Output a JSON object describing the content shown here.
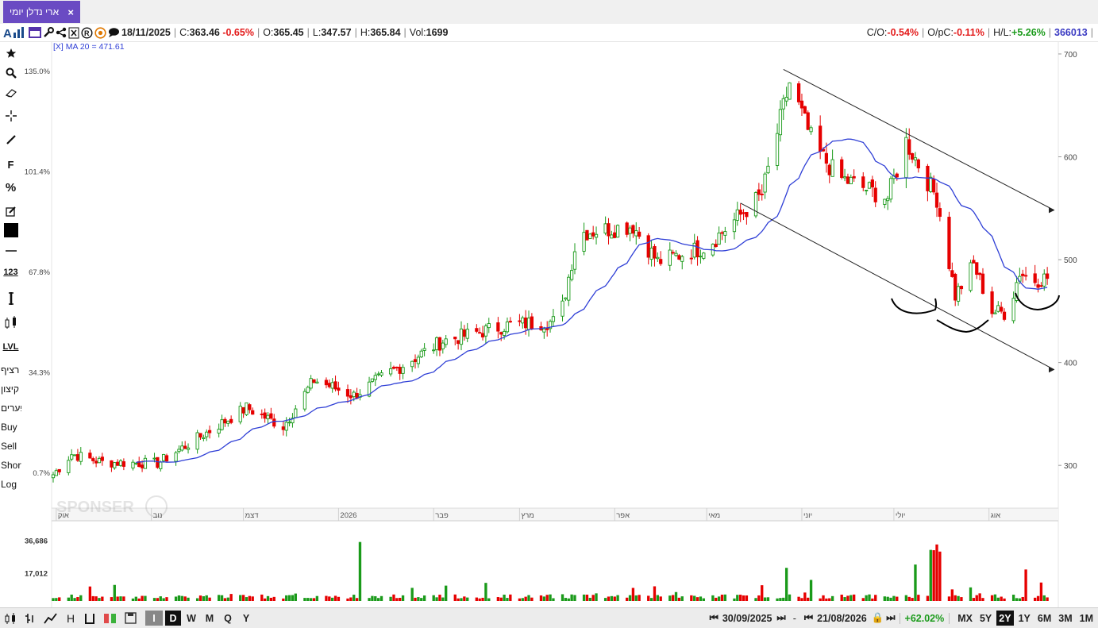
{
  "tab": {
    "label": "ארי נדלן יומי",
    "close": "×"
  },
  "infobar": {
    "date": "18/11/2025",
    "close_label": "C:",
    "close_value": "363.46",
    "close_change": "-0.65%",
    "open_label": "O:",
    "open_value": "365.45",
    "low_label": "L:",
    "low_value": "347.57",
    "high_label": "H:",
    "high_value": "365.84",
    "vol_label": "Vol:",
    "vol_value": "1699",
    "co_label": "C/O:",
    "co_value": "-0.54%",
    "opc_label": "O/pC:",
    "opc_value": "-0.11%",
    "hl_label": "H/L:",
    "hl_value": "+5.26%",
    "security_id": "366013"
  },
  "toolbar_left": {
    "font_label": "F",
    "percent_label": "%",
    "number_label": "123",
    "level_label": "LVL",
    "continuous": "רציף",
    "extreme": "קיצון",
    "gaps": "פערים",
    "buy": "Buy",
    "sell": "Sell",
    "short": "Short",
    "log": "Log"
  },
  "chart": {
    "indicator_label": "[X] MA 20 = 471.61",
    "watermark": "SPONSER",
    "pct_ticks": [
      "135.0%",
      "101.4%",
      "67.8%",
      "34.3%",
      "0.7%"
    ],
    "price_ticks": [
      "700",
      "600",
      "500",
      "400",
      "300"
    ],
    "month_labels": [
      "אוק",
      "נוב",
      "דצמ",
      "2026",
      "פבר",
      "מרץ",
      "אפר",
      "מאי",
      "יוני",
      "יולי",
      "אוג"
    ],
    "volume_ticks": [
      "36,686",
      "17,012"
    ],
    "colors": {
      "up": "#1a9a1a",
      "down": "#e60000",
      "ma": "#2f3fd6",
      "grid": "#dcdcdc"
    }
  },
  "chart_data": {
    "type": "candlestick",
    "x_range": [
      "2025-09-30",
      "2026-08-21"
    ],
    "ylim": [
      260,
      710
    ],
    "moving_average": {
      "name": "MA 20",
      "last_value": 471.61
    },
    "close_anchors": [
      {
        "date": "2025-09-30",
        "close": 291
      },
      {
        "date": "2025-10-06",
        "close": 311
      },
      {
        "date": "2025-10-16",
        "close": 303
      },
      {
        "date": "2025-11-03",
        "close": 302
      },
      {
        "date": "2025-11-18",
        "close": 330
      },
      {
        "date": "2025-12-02",
        "close": 356
      },
      {
        "date": "2025-12-14",
        "close": 338
      },
      {
        "date": "2025-12-24",
        "close": 383
      },
      {
        "date": "2026-01-06",
        "close": 368
      },
      {
        "date": "2026-01-16",
        "close": 387
      },
      {
        "date": "2026-02-04",
        "close": 421
      },
      {
        "date": "2026-02-26",
        "close": 437
      },
      {
        "date": "2026-03-14",
        "close": 440
      },
      {
        "date": "2026-03-20",
        "close": 526
      },
      {
        "date": "2026-04-07",
        "close": 533
      },
      {
        "date": "2026-04-15",
        "close": 498
      },
      {
        "date": "2026-05-01",
        "close": 513
      },
      {
        "date": "2026-05-19",
        "close": 563
      },
      {
        "date": "2026-05-28",
        "close": 672
      },
      {
        "date": "2026-06-05",
        "close": 610
      },
      {
        "date": "2026-06-13",
        "close": 580
      },
      {
        "date": "2026-06-29",
        "close": 560
      },
      {
        "date": "2026-07-05",
        "close": 615
      },
      {
        "date": "2026-07-15",
        "close": 560
      },
      {
        "date": "2026-07-21",
        "close": 465
      },
      {
        "date": "2026-07-27",
        "close": 495
      },
      {
        "date": "2026-08-02",
        "close": 450
      },
      {
        "date": "2026-08-07",
        "close": 448
      },
      {
        "date": "2026-08-11",
        "close": 488
      },
      {
        "date": "2026-08-15",
        "close": 480
      },
      {
        "date": "2026-08-21",
        "close": 483
      }
    ],
    "channel": {
      "upper": [
        {
          "date": "2026-05-26",
          "price": 685
        },
        {
          "date": "2026-09-05",
          "price": 548
        }
      ],
      "lower": [
        {
          "date": "2026-05-12",
          "price": 555
        },
        {
          "date": "2026-09-05",
          "price": 393
        }
      ]
    },
    "volume_ylim": [
      0,
      45000
    ]
  },
  "bottombar": {
    "btn_d": "D",
    "btn_w": "W",
    "btn_m": "M",
    "btn_q": "Q",
    "btn_y": "Y",
    "start_date": "30/09/2025",
    "dash": "-",
    "end_date": "21/08/2026",
    "pct_change": "+62.02%",
    "ranges": [
      "MX",
      "5Y",
      "2Y",
      "1Y",
      "6M",
      "3M",
      "1M"
    ],
    "active_range": "2Y"
  }
}
